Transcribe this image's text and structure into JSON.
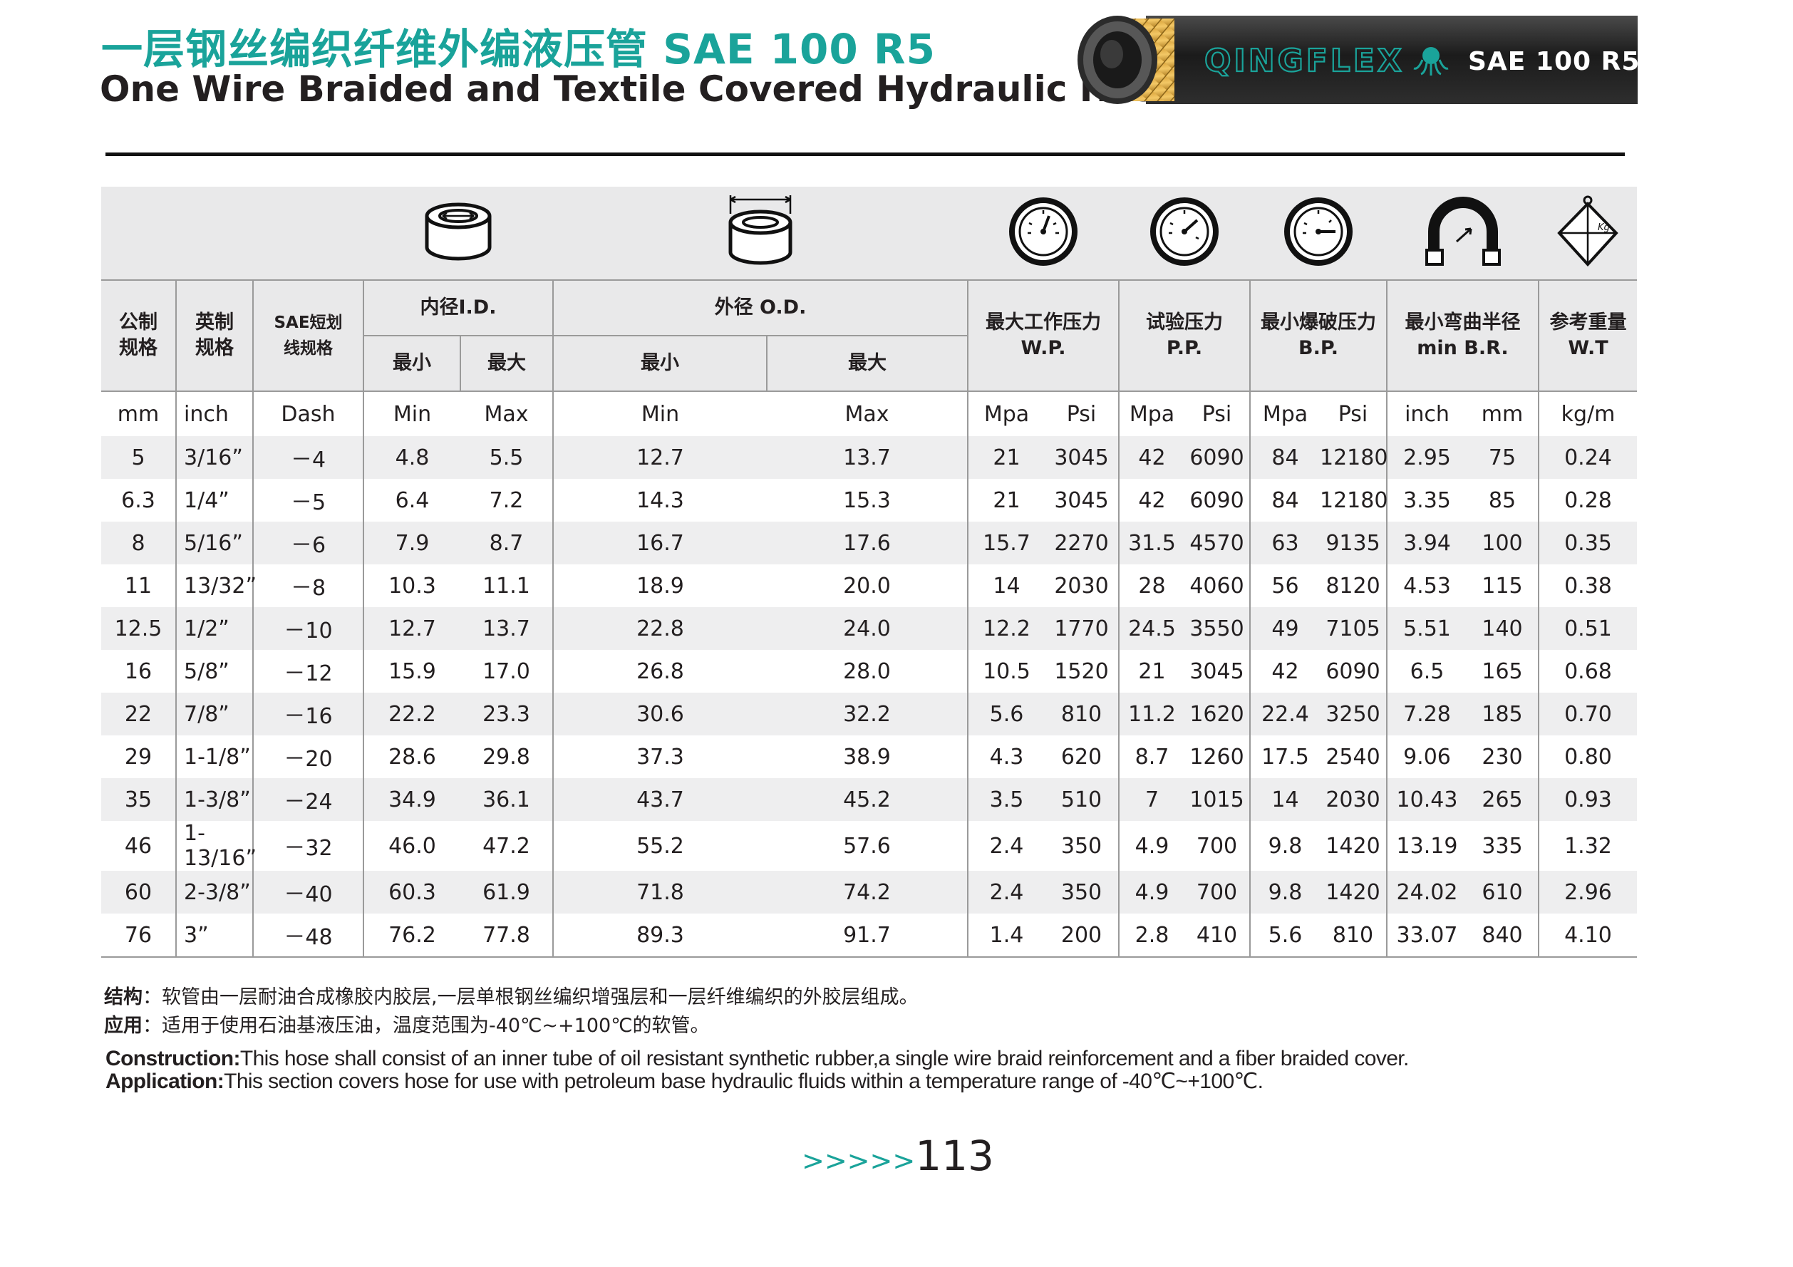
{
  "title": {
    "cn": "一层钢丝编织纤维外编液压管 SAE 100 R5",
    "en": "One Wire Braided and Textile Covered Hydraulic Hose"
  },
  "product_image": {
    "brand": "QINGFLEX",
    "spec": "SAE 100 R5"
  },
  "icons": [
    "inner-diameter-icon",
    "outer-diameter-icon",
    "working-pressure-gauge-icon",
    "proof-pressure-gauge-icon",
    "burst-pressure-gauge-icon",
    "bend-radius-icon",
    "weight-icon"
  ],
  "headers": {
    "nominal": "公制\n规格",
    "inch": "英制\n规格",
    "sae": "SAE短划\n线规格",
    "id": "内径I.D.",
    "od": "外径 O.D.",
    "min": "最小",
    "max": "最大",
    "wp": "最大工作压力\nW.P.",
    "pp": "试验压力\nP.P.",
    "bp": "最小爆破压力\nB.P.",
    "br": "最小弯曲半径\nmin B.R.",
    "wt": "参考重量\nW.T"
  },
  "units": [
    "mm",
    "inch",
    "Dash",
    "Min",
    "Max",
    "Min",
    "Max",
    "Mpa",
    "Psi",
    "Mpa",
    "Psi",
    "Mpa",
    "Psi",
    "inch",
    "mm",
    "kg/m"
  ],
  "rows": [
    [
      "5",
      "3/16”",
      "－4",
      "4.8",
      "5.5",
      "12.7",
      "13.7",
      "21",
      "3045",
      "42",
      "6090",
      "84",
      "12180",
      "2.95",
      "75",
      "0.24"
    ],
    [
      "6.3",
      "1/4”",
      "－5",
      "6.4",
      "7.2",
      "14.3",
      "15.3",
      "21",
      "3045",
      "42",
      "6090",
      "84",
      "12180",
      "3.35",
      "85",
      "0.28"
    ],
    [
      "8",
      "5/16”",
      "－6",
      "7.9",
      "8.7",
      "16.7",
      "17.6",
      "15.7",
      "2270",
      "31.5",
      "4570",
      "63",
      "9135",
      "3.94",
      "100",
      "0.35"
    ],
    [
      "11",
      "13/32”",
      "－8",
      "10.3",
      "11.1",
      "18.9",
      "20.0",
      "14",
      "2030",
      "28",
      "4060",
      "56",
      "8120",
      "4.53",
      "115",
      "0.38"
    ],
    [
      "12.5",
      "1/2”",
      "－10",
      "12.7",
      "13.7",
      "22.8",
      "24.0",
      "12.2",
      "1770",
      "24.5",
      "3550",
      "49",
      "7105",
      "5.51",
      "140",
      "0.51"
    ],
    [
      "16",
      "5/8”",
      "－12",
      "15.9",
      "17.0",
      "26.8",
      "28.0",
      "10.5",
      "1520",
      "21",
      "3045",
      "42",
      "6090",
      "6.5",
      "165",
      "0.68"
    ],
    [
      "22",
      "7/8”",
      "－16",
      "22.2",
      "23.3",
      "30.6",
      "32.2",
      "5.6",
      "810",
      "11.2",
      "1620",
      "22.4",
      "3250",
      "7.28",
      "185",
      "0.70"
    ],
    [
      "29",
      "1-1/8”",
      "－20",
      "28.6",
      "29.8",
      "37.3",
      "38.9",
      "4.3",
      "620",
      "8.7",
      "1260",
      "17.5",
      "2540",
      "9.06",
      "230",
      "0.80"
    ],
    [
      "35",
      "1-3/8”",
      "－24",
      "34.9",
      "36.1",
      "43.7",
      "45.2",
      "3.5",
      "510",
      "7",
      "1015",
      "14",
      "2030",
      "10.43",
      "265",
      "0.93"
    ],
    [
      "46",
      "1-13/16”",
      "－32",
      "46.0",
      "47.2",
      "55.2",
      "57.6",
      "2.4",
      "350",
      "4.9",
      "700",
      "9.8",
      "1420",
      "13.19",
      "335",
      "1.32"
    ],
    [
      "60",
      "2-3/8”",
      "－40",
      "60.3",
      "61.9",
      "71.8",
      "74.2",
      "2.4",
      "350",
      "4.9",
      "700",
      "9.8",
      "1420",
      "24.02",
      "610",
      "2.96"
    ],
    [
      "76",
      "3”",
      "－48",
      "76.2",
      "77.8",
      "89.3",
      "91.7",
      "1.4",
      "200",
      "2.8",
      "410",
      "5.6",
      "810",
      "33.07",
      "840",
      "4.10"
    ]
  ],
  "notes": {
    "construction_cn_label": "结构",
    "construction_cn": "：软管由一层耐油合成橡胶内胶层,一层单根钢丝编织增强层和一层纤维编织的外胶层组成。",
    "application_cn_label": "应用",
    "application_cn": "：适用于使用石油基液压油，温度范围为-40℃~+100℃的软管。",
    "construction_en_label": "Construction:",
    "construction_en": "This hose shall consist of an inner tube of oil resistant synthetic rubber,a single wire braid reinforcement and a fiber braided cover.",
    "application_en_label": "Application:",
    "application_en": "This section covers hose for use with petroleum base hydraulic fluids within a temperature range of -40℃~+100℃."
  },
  "page": {
    "arrows": ">>>>>",
    "number": "113"
  },
  "colors": {
    "accent": "#1aa39a",
    "header_bg": "#e9e9ea",
    "stripe": "#eeeeef",
    "text": "#231f20"
  }
}
